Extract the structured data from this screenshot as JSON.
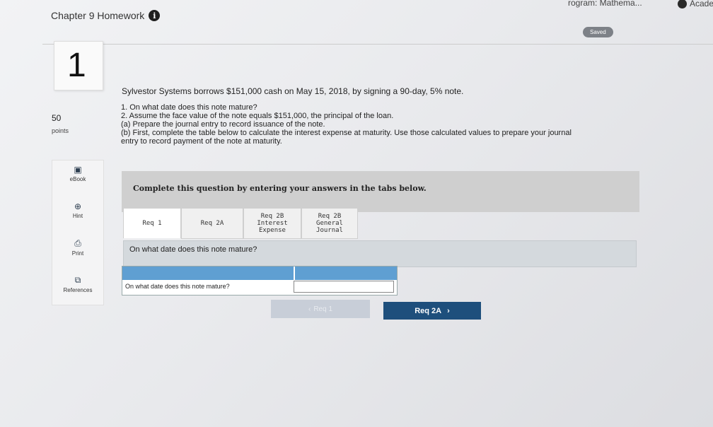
{
  "header": {
    "program_link": "rogram: Mathema...",
    "academic_link": "Academ",
    "chapter_title": "Chapter 9 Homework",
    "info_icon": "info-icon",
    "saved_label": "Saved"
  },
  "question": {
    "number": "1",
    "points_value": "50",
    "points_label": "points",
    "intro": "Sylvestor Systems borrows $151,000 cash on May 15, 2018, by signing a 90-day, 5% note.",
    "requirements": [
      "1. On what date does this note mature?",
      "2. Assume the face value of the note equals $151,000, the principal of the loan.",
      "(a) Prepare the journal entry to record issuance of the note.",
      "(b) First, complete the table below to calculate the interest expense at maturity. Use those calculated values to prepare your journal",
      "entry to record payment of the note at maturity."
    ]
  },
  "side_tools": [
    {
      "label": "eBook",
      "icon": "book-icon"
    },
    {
      "label": "Hint",
      "icon": "hint-globe-icon"
    },
    {
      "label": "Print",
      "icon": "printer-icon"
    },
    {
      "label": "References",
      "icon": "references-icon"
    }
  ],
  "instruction": "Complete this question by entering your answers in the tabs below.",
  "tabs": [
    {
      "label": "Req 1"
    },
    {
      "label": "Req 2A"
    },
    {
      "label": "Req 2B\nInterest\nExpense"
    },
    {
      "label": "Req 2B\nGeneral\nJournal"
    }
  ],
  "tab_question": "On what date does this note mature?",
  "answer_table": {
    "row_label": "On what date does this note mature?",
    "row_value": ""
  },
  "nav": {
    "prev_label": "Req 1",
    "next_label": "Req 2A"
  },
  "colors": {
    "accent_blue": "#5f9fd2",
    "nav_button": "#1e4f7c",
    "banner_gray": "#cfcfcf"
  }
}
